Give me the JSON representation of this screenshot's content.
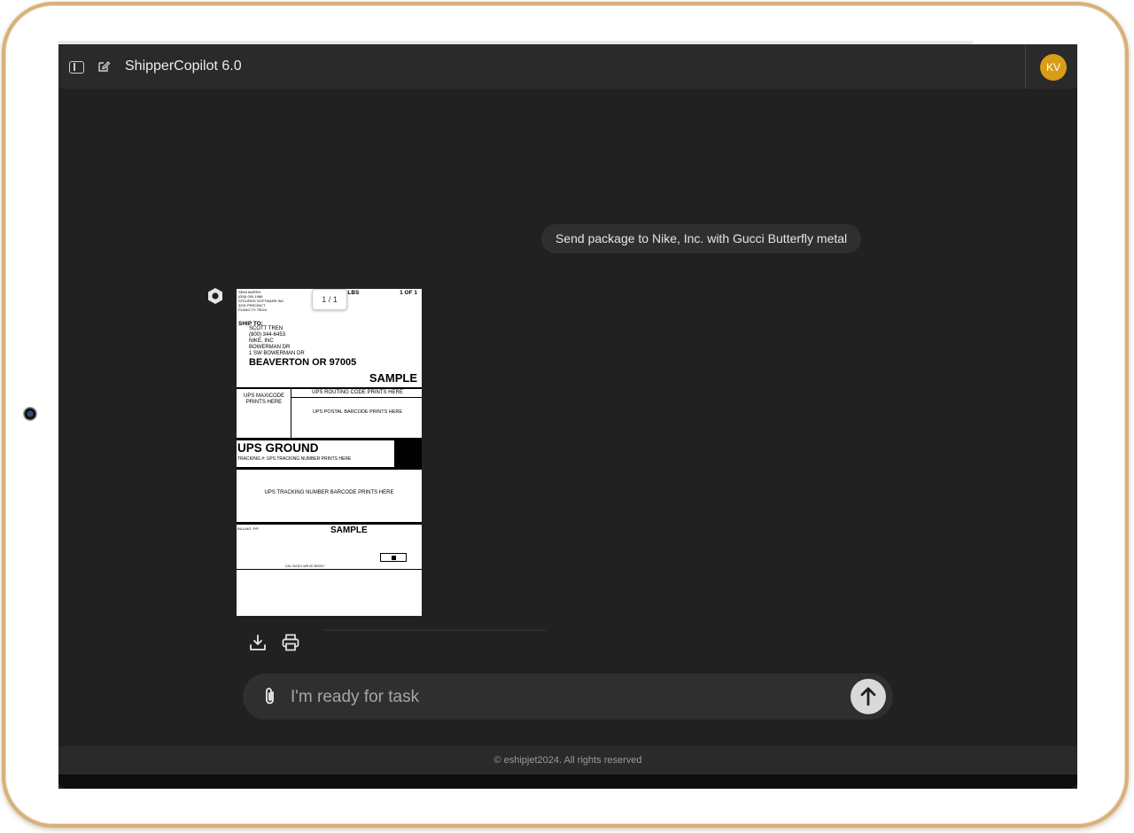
{
  "app": {
    "title": "ShipperCopilot 6.0",
    "avatar_initials": "KV",
    "avatar_color": "#d99c16"
  },
  "conversation": {
    "user_message": "Send package to Nike, Inc. with Gucci Butterfly metal"
  },
  "label": {
    "page_counter": "1 / 1",
    "from_block": "SEMI MARSH\n(000) 000-1968\nSTEUFIED SOFTWARE INC\n3201 PRECINCT\nPLANO TX 75024",
    "weight": "1 LBS",
    "count": "1 OF 1",
    "ship_to_label": "SHIP TO:",
    "ship_to_address": "SCOTT TREN\n(800) 344-6453\nNIKE, INC\nBOWERMAN DR\n1 SW BOWERMAN DR",
    "city_line": "BEAVERTON  OR  97005",
    "sample_1": "SAMPLE",
    "maxicode_text": "UPS\nMAXICODE\nPRINTS HERE",
    "routing_text": "UPS ROUTING CODE PRINTS HERE",
    "postal_text": "UPS POSTAL BARCODE PRINTS HERE",
    "service": "UPS GROUND",
    "tracking_small": "TRACKING #: UPS TRACKING NUMBER PRINTS HERE",
    "tracking_barcode_text": "UPS TRACKING NUMBER BARCODE PRINTS HERE",
    "billing": "BILLING: P/P",
    "sample_2": "SAMPLE",
    "footer_small": "CAL 010101      WR 00 05/2017"
  },
  "actions": {
    "download_icon": "download-icon",
    "print_icon": "print-icon"
  },
  "composer": {
    "placeholder": "I'm ready for task",
    "attach_icon": "paperclip-icon",
    "send_icon": "arrow-up-icon"
  },
  "footer": {
    "copyright": "©  eshipjet2024. All rights reserved"
  }
}
